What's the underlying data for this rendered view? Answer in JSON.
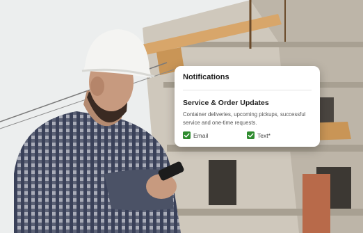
{
  "notifications": {
    "title": "Notifications",
    "section_title": "Service & Order Updates",
    "description": "Container deliveries, upcoming pickups, successful service and one-time requests.",
    "options": [
      {
        "label": "Email",
        "checked": true
      },
      {
        "label": "Text*",
        "checked": true
      }
    ],
    "check_color": "#2e8b2e"
  }
}
